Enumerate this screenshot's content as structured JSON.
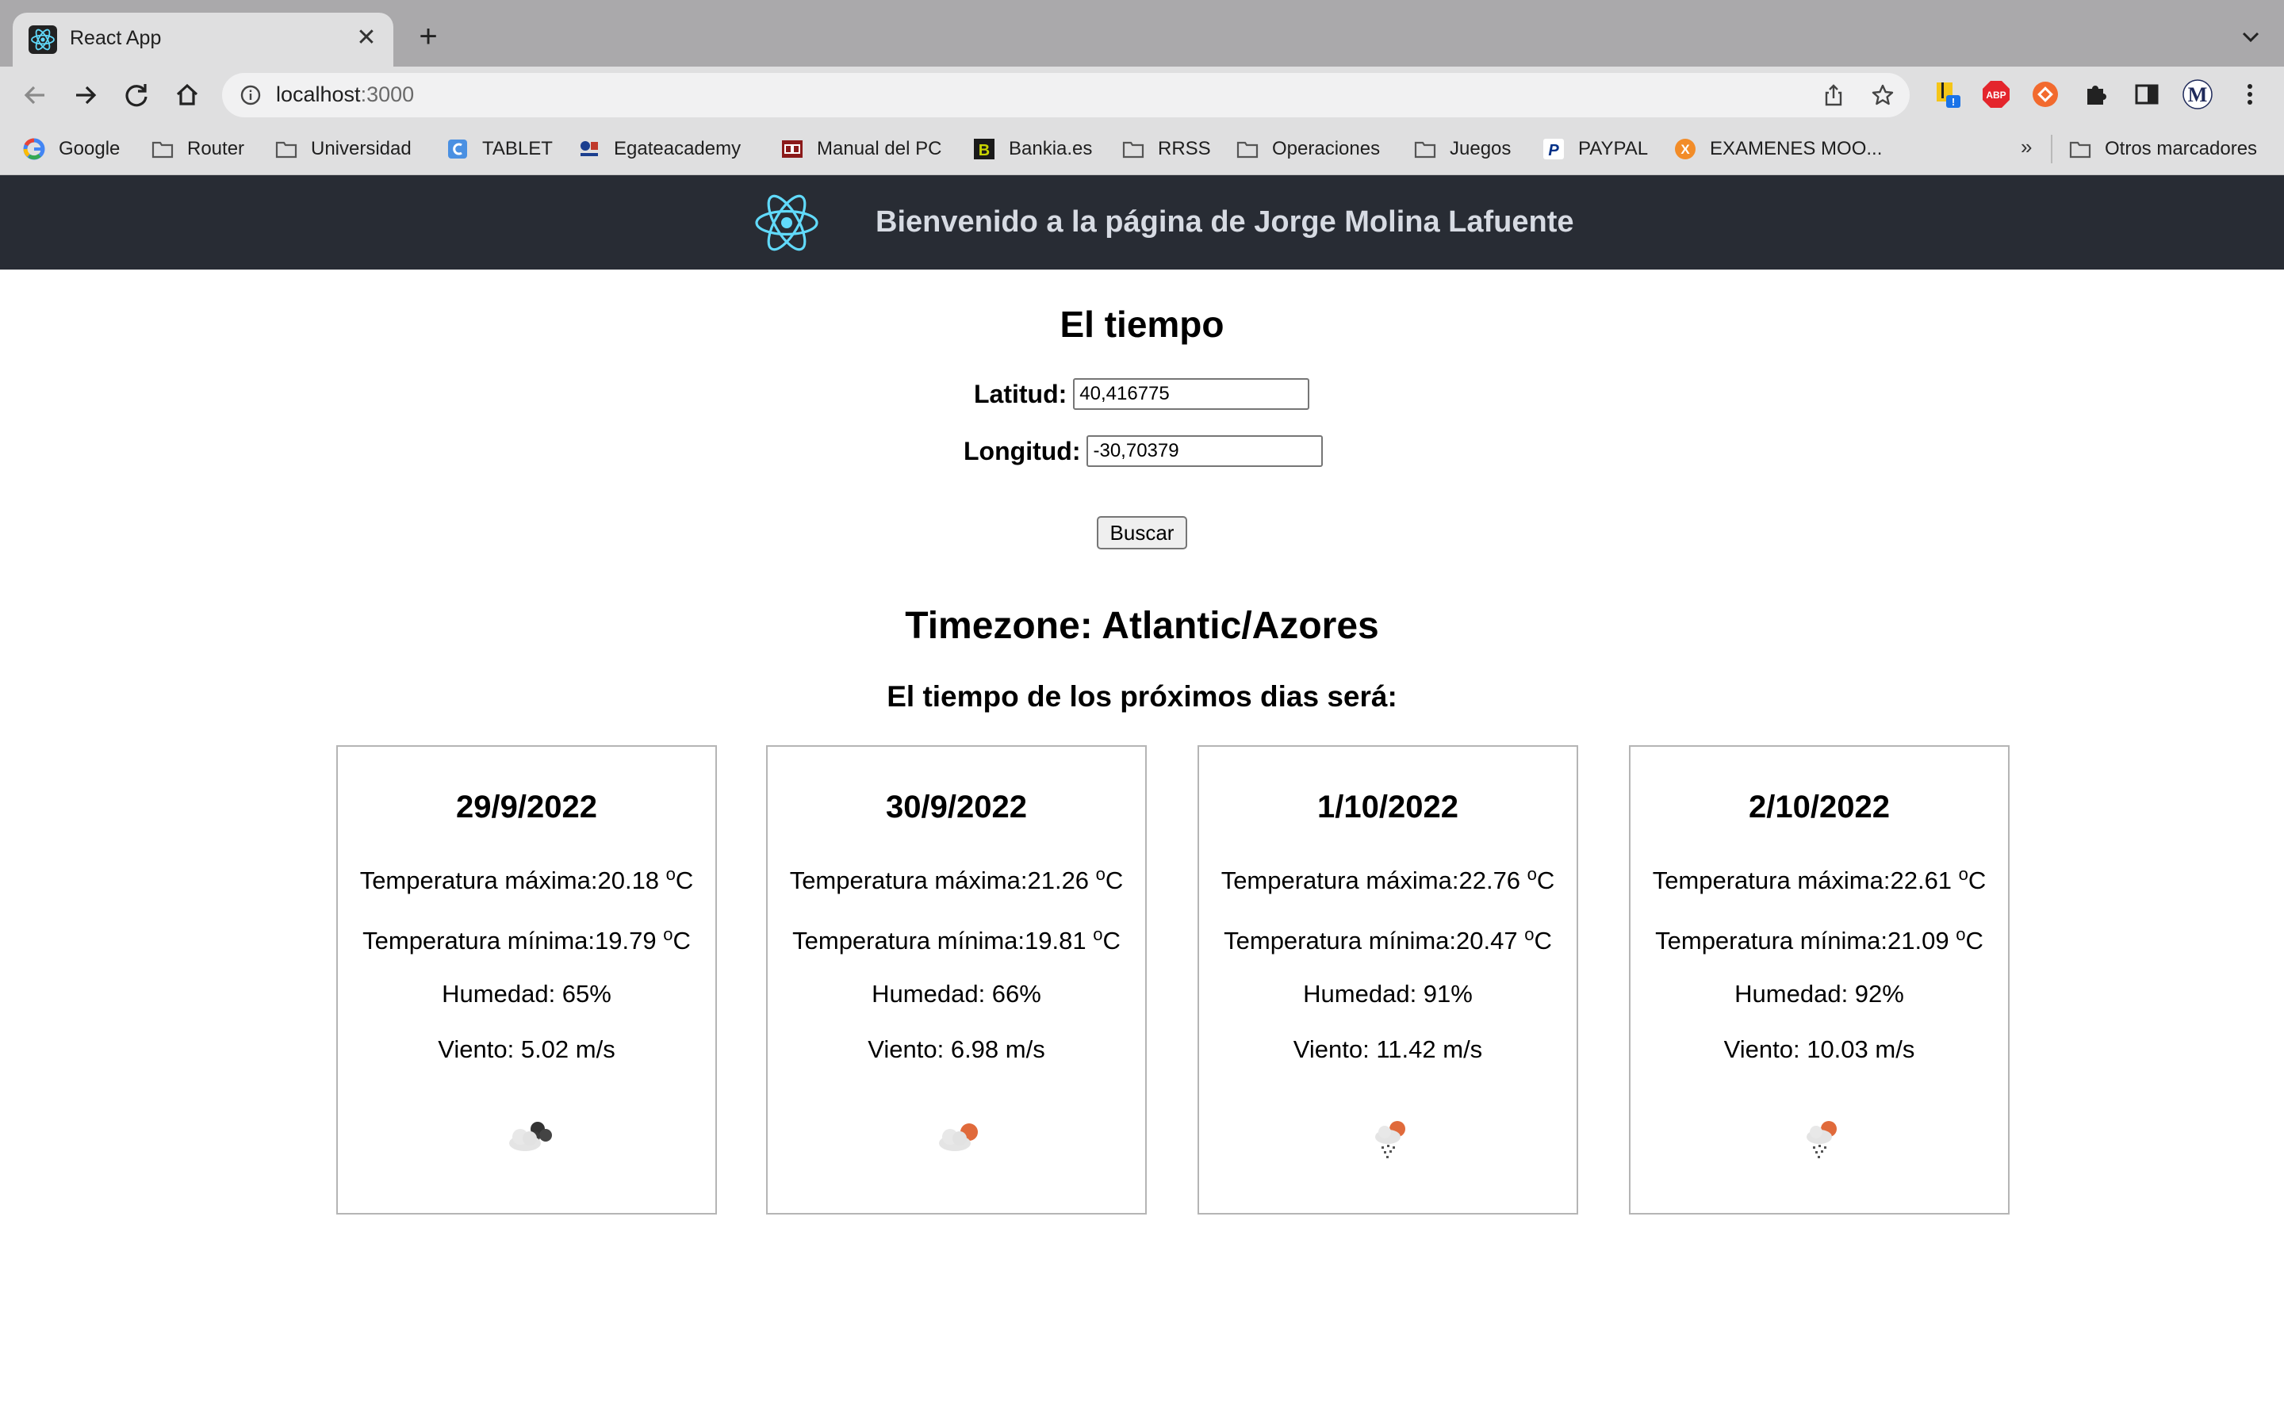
{
  "browser": {
    "tab_title": "React App",
    "url_host": "localhost",
    "url_port": ":3000",
    "bookmarks": [
      {
        "label": "Google",
        "icon": "google-icon"
      },
      {
        "label": "Router",
        "icon": "folder-icon"
      },
      {
        "label": "Universidad",
        "icon": "folder-icon"
      },
      {
        "label": "TABLET",
        "icon": "tablet-site-icon"
      },
      {
        "label": "Egateacademy",
        "icon": "egate-icon"
      },
      {
        "label": "Manual del PC",
        "icon": "manual-icon"
      },
      {
        "label": "Bankia.es",
        "icon": "bankia-icon"
      },
      {
        "label": "RRSS",
        "icon": "folder-icon"
      },
      {
        "label": "Operaciones",
        "icon": "folder-icon"
      },
      {
        "label": "Juegos",
        "icon": "folder-icon"
      },
      {
        "label": "PAYPAL",
        "icon": "paypal-icon"
      },
      {
        "label": "EXAMENES MOO...",
        "icon": "x-site-icon"
      }
    ],
    "more_bookmarks": "»",
    "other_bookmarks": "Otros marcadores",
    "extension_badges": {
      "abp": "ABP",
      "profile": "M"
    }
  },
  "app": {
    "header_title": "Bienvenido a la página de Jorge Molina Lafuente",
    "page_title": "El tiempo",
    "latitude_label": "Latitud:",
    "latitude_value": "40,416775",
    "longitude_label": "Longitud:",
    "longitude_value": "-30,70379",
    "search_button": "Buscar",
    "timezone": "Timezone: Atlantic/Azores",
    "forecast_heading": "El tiempo de los próximos dias será:",
    "labels": {
      "max": "Temperatura máxima:",
      "min": "Temperatura mínima:",
      "unit_sup": "o",
      "unit_c": "C"
    },
    "days": [
      {
        "date": "29/9/2022",
        "max": "20.18",
        "min": "19.79",
        "humidity": "Humedad: 65%",
        "wind": "Viento: 5.02 m/s",
        "icon": "broken-clouds-icon"
      },
      {
        "date": "30/9/2022",
        "max": "21.26",
        "min": "19.81",
        "humidity": "Humedad: 66%",
        "wind": "Viento: 6.98 m/s",
        "icon": "few-clouds-icon"
      },
      {
        "date": "1/10/2022",
        "max": "22.76",
        "min": "20.47",
        "humidity": "Humedad: 91%",
        "wind": "Viento: 11.42 m/s",
        "icon": "rain-icon"
      },
      {
        "date": "2/10/2022",
        "max": "22.61",
        "min": "21.09",
        "humidity": "Humedad: 92%",
        "wind": "Viento: 10.03 m/s",
        "icon": "rain-icon"
      }
    ]
  }
}
